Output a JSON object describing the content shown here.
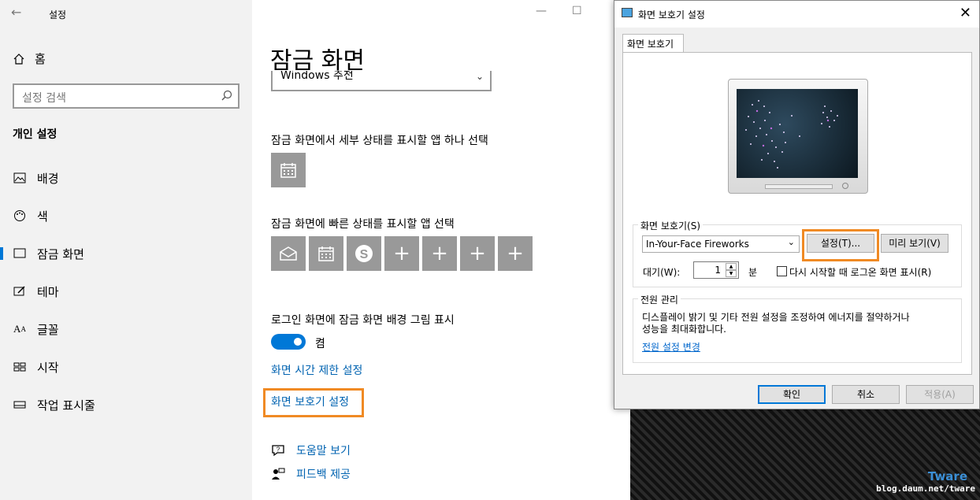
{
  "settings": {
    "title": "설정",
    "home": "홈",
    "search_placeholder": "설정 검색",
    "section": "개인 설정",
    "nav": [
      {
        "label": "배경",
        "icon": "image-icon"
      },
      {
        "label": "색",
        "icon": "palette-icon"
      },
      {
        "label": "잠금 화면",
        "icon": "lock-screen-icon",
        "active": true
      },
      {
        "label": "테마",
        "icon": "theme-icon"
      },
      {
        "label": "글꼴",
        "icon": "font-icon"
      },
      {
        "label": "시작",
        "icon": "start-icon"
      },
      {
        "label": "작업 표시줄",
        "icon": "taskbar-icon"
      }
    ]
  },
  "lock": {
    "heading": "잠금 화면",
    "combo_value": "Windows 추천",
    "detail_label": "잠금 화면에서 세부 상태를 표시할 앱 하나 선택",
    "quick_label": "잠금 화면에 빠른 상태를 표시할 앱 선택",
    "signin_label": "로그인 화면에 잠금 화면 배경 그림 표시",
    "toggle_state": "켬",
    "timeout_link": "화면 시간 제한 설정",
    "screensaver_link": "화면 보호기 설정",
    "help_link": "도움말 보기",
    "feedback_link": "피드백 제공"
  },
  "dialog": {
    "title": "화면 보호기 설정",
    "tab": "화면 보호기",
    "group_saver": "화면 보호기(S)",
    "saver_value": "In-Your-Face Fireworks",
    "settings_btn": "설정(T)...",
    "preview_btn": "미리 보기(V)",
    "wait_label": "대기(W):",
    "wait_value": "1",
    "wait_unit": "분",
    "resume_label": "다시 시작할 때 로그온 화면 표시(R)",
    "group_power": "전원 관리",
    "power_text1": "디스플레이 밝기 및 기타 전원 설정을 조정하여 에너지를 절약하거나",
    "power_text2": "성능을 최대화합니다.",
    "power_link": "전원 설정 변경",
    "ok": "확인",
    "cancel": "취소",
    "apply": "적용(A)"
  },
  "watermark": {
    "brand": "Tware",
    "url": "blog.daum.net/tware"
  },
  "colors": {
    "accent": "#0078d7",
    "highlight": "#f08a24",
    "link": "#0063b1"
  }
}
